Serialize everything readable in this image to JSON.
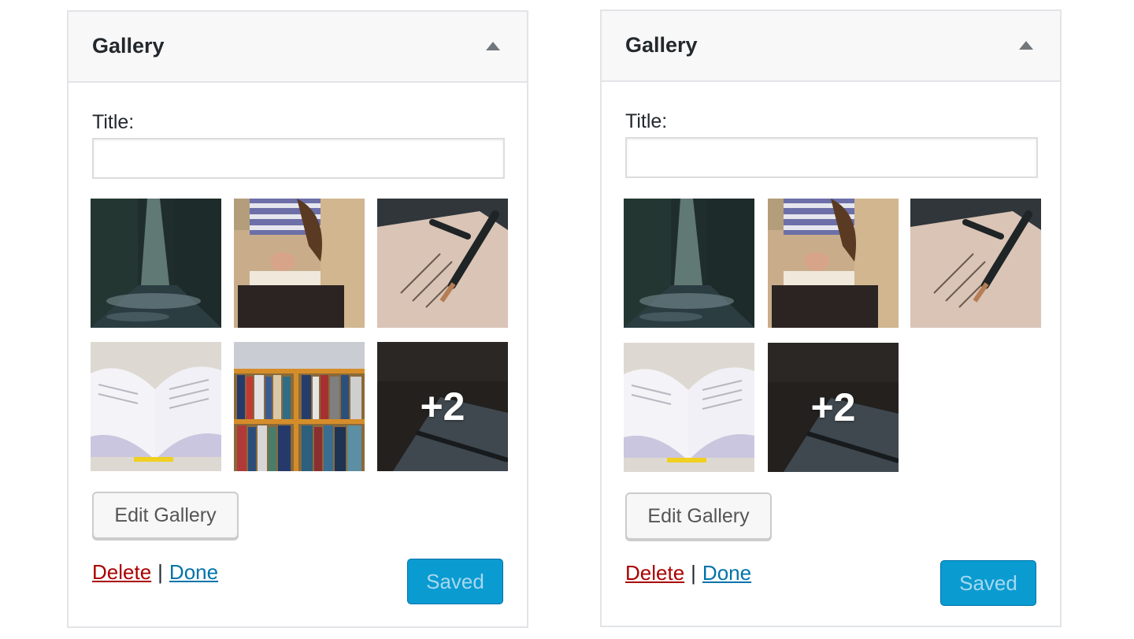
{
  "widgets": [
    {
      "title": "Gallery",
      "field_label": "Title:",
      "field_value": "",
      "more_count": "+2",
      "edit_label": "Edit Gallery",
      "delete_label": "Delete",
      "separator": "|",
      "done_label": "Done",
      "saved_label": "Saved"
    },
    {
      "title": "Gallery",
      "field_label": "Title:",
      "field_value": "",
      "more_count": "+2",
      "edit_label": "Edit Gallery",
      "delete_label": "Delete",
      "separator": "|",
      "done_label": "Done",
      "saved_label": "Saved"
    }
  ],
  "colors": {
    "delete_link": "#aa0000",
    "done_link": "#0073aa",
    "saved_button": "#0a9bd1"
  },
  "thumbnails": [
    "forest-road-photo",
    "woman-reading-photo",
    "fountain-pen-letter-photo",
    "open-book-photo",
    "bookshelf-photo",
    "notebook-pen-photo"
  ]
}
